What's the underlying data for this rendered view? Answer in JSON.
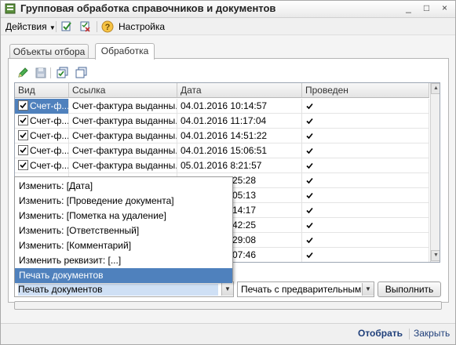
{
  "window": {
    "title": "Групповая обработка справочников и документов",
    "controls": [
      "_",
      "□",
      "×"
    ]
  },
  "toolbar": {
    "actions_label": "Действия",
    "settings_label": "Настройка",
    "icons": [
      "select-all-icon",
      "deselect-icon",
      "help-icon"
    ]
  },
  "tabs": [
    {
      "label": "Объекты отбора",
      "active": false
    },
    {
      "label": "Обработка",
      "active": true
    }
  ],
  "panel_toolbar_icons": [
    "edit-pencil-icon",
    "save-disk-icon",
    "check-all-icon",
    "copy-icon"
  ],
  "table": {
    "columns": [
      "Вид",
      "Ссылка",
      "Дата",
      "Проведен"
    ],
    "rows": [
      {
        "checked": true,
        "kind": "Счет-ф...",
        "ref": "Счет-фактура выданны...",
        "date": "04.01.2016 10:14:57",
        "posted": true
      },
      {
        "checked": true,
        "kind": "Счет-ф...",
        "ref": "Счет-фактура выданны...",
        "date": "04.01.2016 11:17:04",
        "posted": true
      },
      {
        "checked": true,
        "kind": "Счет-ф...",
        "ref": "Счет-фактура выданны...",
        "date": "04.01.2016 14:51:22",
        "posted": true
      },
      {
        "checked": true,
        "kind": "Счет-ф...",
        "ref": "Счет-фактура выданны...",
        "date": "04.01.2016 15:06:51",
        "posted": true
      },
      {
        "checked": true,
        "kind": "Счет-ф...",
        "ref": "Счет-фактура выданны...",
        "date": "05.01.2016 8:21:57",
        "posted": true
      },
      {
        "checked": false,
        "kind": "",
        "ref": "",
        "date": "25:28",
        "posted": true
      },
      {
        "checked": false,
        "kind": "",
        "ref": "",
        "date": "05:13",
        "posted": true
      },
      {
        "checked": false,
        "kind": "",
        "ref": "",
        "date": "14:17",
        "posted": true
      },
      {
        "checked": false,
        "kind": "",
        "ref": "",
        "date": "42:25",
        "posted": true
      },
      {
        "checked": false,
        "kind": "",
        "ref": "",
        "date": "29:08",
        "posted": true
      },
      {
        "checked": false,
        "kind": "",
        "ref": "",
        "date": "07:46",
        "posted": true
      }
    ]
  },
  "popup_items": [
    {
      "label": "Изменить: [Дата]",
      "selected": false
    },
    {
      "label": "Изменить: [Проведение документа]",
      "selected": false
    },
    {
      "label": "Изменить: [Пометка на удаление]",
      "selected": false
    },
    {
      "label": "Изменить: [Ответственный]",
      "selected": false
    },
    {
      "label": "Изменить: [Комментарий]",
      "selected": false
    },
    {
      "label": "Изменить реквизит: [...]",
      "selected": false
    },
    {
      "label": "Печать документов",
      "selected": true
    }
  ],
  "action_combo": {
    "value": "Печать документов"
  },
  "print_mode_combo": {
    "value": "Печать с предварительным пр"
  },
  "execute_button": {
    "label": "Выполнить"
  },
  "footer": {
    "select_label": "Отобрать",
    "close_label": "Закрыть"
  },
  "colors": {
    "selection": "#4f81bd",
    "accent_text": "#1f3f7a"
  }
}
